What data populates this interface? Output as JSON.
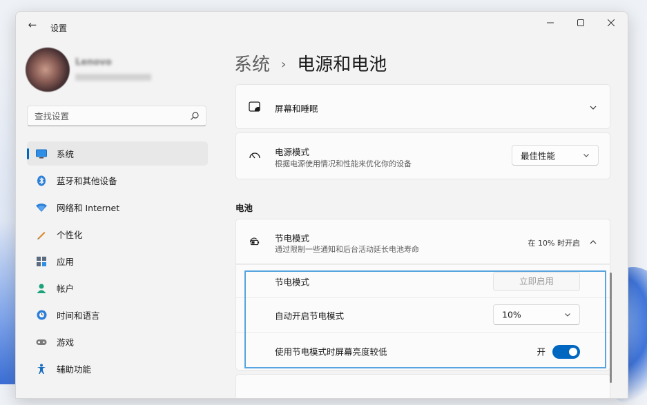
{
  "window": {
    "title": "设置"
  },
  "user": {
    "name": "Lenovo",
    "email": ""
  },
  "search": {
    "placeholder": "查找设置"
  },
  "sidebar": {
    "items": [
      {
        "label": "系统",
        "icon": "monitor-icon",
        "selected": true
      },
      {
        "label": "蓝牙和其他设备",
        "icon": "bluetooth-icon"
      },
      {
        "label": "网络和 Internet",
        "icon": "wifi-icon"
      },
      {
        "label": "个性化",
        "icon": "pen-icon"
      },
      {
        "label": "应用",
        "icon": "apps-icon"
      },
      {
        "label": "帐户",
        "icon": "person-icon"
      },
      {
        "label": "时间和语言",
        "icon": "globe-clock-icon"
      },
      {
        "label": "游戏",
        "icon": "gamepad-icon"
      },
      {
        "label": "辅助功能",
        "icon": "accessibility-icon"
      }
    ]
  },
  "breadcrumb": {
    "parent": "系统",
    "separator": "›",
    "current": "电源和电池"
  },
  "screen_sleep": {
    "title": "屏幕和睡眠"
  },
  "power_mode": {
    "title": "电源模式",
    "subtitle": "根据电源使用情况和性能来优化你的设备",
    "value": "最佳性能"
  },
  "battery_section": {
    "label": "电池"
  },
  "battery_saver": {
    "title": "节电模式",
    "subtitle": "通过限制一些通知和后台活动延长电池寿命",
    "status": "在 10% 时开启",
    "row_saver_label": "节电模式",
    "turn_on_now": "立即启用",
    "auto_label": "自动开启节电模式",
    "auto_value": "10%",
    "dim_label": "使用节电模式时屏幕亮度较低",
    "dim_state": "开",
    "dim_on": true
  },
  "colors": {
    "accent": "#0067c0",
    "highlight_box": "#56a4e0"
  }
}
